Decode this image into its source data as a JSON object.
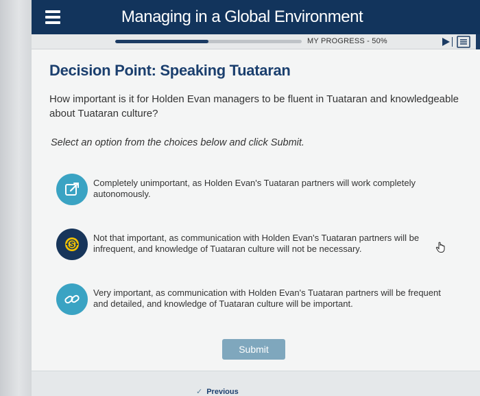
{
  "header": {
    "title": "Managing in a Global Environment"
  },
  "progress": {
    "label": "MY PROGRESS - 50%",
    "fraction": 0.5
  },
  "toolbar": {
    "icons": [
      "play-icon",
      "notes-icon"
    ]
  },
  "content": {
    "section_title": "Decision Point: Speaking Tuataran",
    "question": "How important is it for Holden Evan managers to be fluent in Tuataran and knowledgeable about Tuataran culture?",
    "instruction": "Select an option from the choices below and click Submit.",
    "options": [
      {
        "icon": "edit-icon",
        "text": "Completely unimportant, as Holden Evan's Tuataran partners will work completely autonomously."
      },
      {
        "icon": "money-icon",
        "text": "Not that important, as communication with Holden Evan's Tuataran partners will be infrequent, and knowledge of Tuataran culture will not be necessary."
      },
      {
        "icon": "link-icon",
        "text": "Very important, as communication with Holden Evan's Tuataran partners will be frequent and detailed, and knowledge of Tuataran culture will be important."
      }
    ],
    "submit_label": "Submit"
  },
  "footer": {
    "previous_label": "Previous"
  },
  "colors": {
    "header_bg": "#12345c",
    "title_blue": "#1b3f6e",
    "option_teal": "#3aa3c3",
    "option_navy": "#17355a",
    "submit_bg": "#7fa7bd"
  }
}
